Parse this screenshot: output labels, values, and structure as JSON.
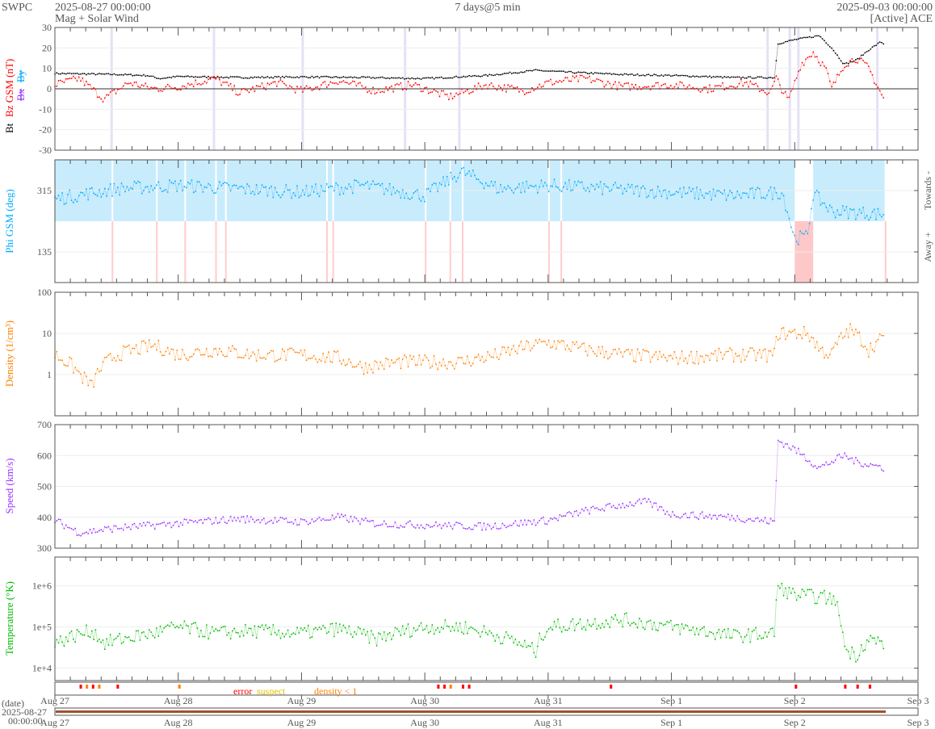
{
  "header": {
    "org": "SWPC",
    "start": "2025-08-27 00:00:00",
    "product": "Mag + Solar Wind",
    "span": "7 days@5 min",
    "end": "2025-09-03 00:00:00",
    "source": "[Active] ACE"
  },
  "footer": {
    "date_label": "(date)",
    "date_value": "2025-08-27",
    "time_value": "00:00:00"
  },
  "flags_legend": {
    "error": "error",
    "suspect": "suspect",
    "density": "density < 1"
  },
  "colors": {
    "bt": "#000000",
    "bz": "#ff0000",
    "bx": "#9933ff",
    "by": "#00aaff",
    "phi": "#00aaff",
    "density": "#ff8000",
    "speed": "#9933ff",
    "temperature": "#00bb00",
    "towards": "#c8ecfc",
    "away": "#ffc8c8"
  },
  "chart_data": {
    "type": "line",
    "x_unit": "days since 2025-08-27 00:00 UTC",
    "xlim": [
      0,
      7
    ],
    "x_ticks": [
      "Aug 27",
      "Aug 28",
      "Aug 29",
      "Aug 30",
      "Aug 31",
      "Sep 1",
      "Sep 2",
      "Sep 3"
    ],
    "panels": [
      {
        "id": "mag",
        "ylabels": {
          "bt": "Bt",
          "bz": "Bz GSM (nT)",
          "bx": "Bx",
          "by": "By"
        },
        "ylim": [
          -30,
          30
        ],
        "scale": "linear",
        "yticks": [
          "30",
          "20",
          "10",
          "0",
          "-10",
          "-20",
          "-30"
        ],
        "series": [
          {
            "name": "Bt",
            "color": "#000000",
            "points": [
              [
                0,
                7.5
              ],
              [
                0.5,
                7
              ],
              [
                0.75,
                6.5
              ],
              [
                0.85,
                5
              ],
              [
                1,
                6
              ],
              [
                1.5,
                5.5
              ],
              [
                2,
                5.8
              ],
              [
                2.5,
                5.5
              ],
              [
                3,
                5
              ],
              [
                3.5,
                6.5
              ],
              [
                3.9,
                9
              ],
              [
                4.2,
                8
              ],
              [
                4.6,
                7
              ],
              [
                5,
                6.5
              ],
              [
                5.5,
                5.5
              ],
              [
                5.84,
                5.5
              ],
              [
                5.86,
                22
              ],
              [
                6,
                24
              ],
              [
                6.2,
                26
              ],
              [
                6.3,
                20
              ],
              [
                6.4,
                12
              ],
              [
                6.5,
                14
              ],
              [
                6.6,
                19
              ],
              [
                6.7,
                23
              ],
              [
                6.73,
                21.5
              ]
            ]
          },
          {
            "name": "Bz GSM",
            "color": "#ff0000",
            "points": [
              [
                0,
                2
              ],
              [
                0.2,
                5
              ],
              [
                0.4,
                -5
              ],
              [
                0.6,
                3
              ],
              [
                0.8,
                0
              ],
              [
                1,
                1
              ],
              [
                1.3,
                5
              ],
              [
                1.5,
                -2
              ],
              [
                1.8,
                3
              ],
              [
                2,
                -1
              ],
              [
                2.3,
                4
              ],
              [
                2.6,
                -1
              ],
              [
                2.9,
                2
              ],
              [
                3.2,
                -4
              ],
              [
                3.5,
                2
              ],
              [
                3.8,
                -1
              ],
              [
                4,
                3
              ],
              [
                4.3,
                5
              ],
              [
                4.6,
                1
              ],
              [
                5,
                2
              ],
              [
                5.3,
                0
              ],
              [
                5.6,
                3
              ],
              [
                5.8,
                -2
              ],
              [
                5.85,
                5
              ],
              [
                5.95,
                -6
              ],
              [
                6.05,
                12
              ],
              [
                6.15,
                18
              ],
              [
                6.25,
                10
              ],
              [
                6.3,
                0
              ],
              [
                6.4,
                12
              ],
              [
                6.5,
                15
              ],
              [
                6.6,
                10
              ],
              [
                6.73,
                -6
              ]
            ]
          }
        ]
      },
      {
        "id": "phi",
        "ylabel": "Phi GSM (deg)",
        "ylim": [
          45,
          405
        ],
        "scale": "linear",
        "yticks": [
          "315",
          "135"
        ],
        "right_labels": {
          "towards": "Towards -",
          "away": "Away +"
        },
        "series": [
          {
            "name": "Phi",
            "color": "#00aaff",
            "points": [
              [
                0,
                290
              ],
              [
                0.5,
                320
              ],
              [
                1,
                330
              ],
              [
                1.5,
                320
              ],
              [
                2,
                310
              ],
              [
                2.5,
                330
              ],
              [
                3,
                300
              ],
              [
                3.3,
                370
              ],
              [
                3.6,
                320
              ],
              [
                4,
                330
              ],
              [
                4.5,
                320
              ],
              [
                5,
                310
              ],
              [
                5.5,
                300
              ],
              [
                5.9,
                310
              ],
              [
                6.0,
                175
              ],
              [
                6.1,
                180
              ],
              [
                6.15,
                305
              ],
              [
                6.3,
                255
              ],
              [
                6.73,
                245
              ]
            ]
          }
        ]
      },
      {
        "id": "density",
        "ylabel": "Density (1/cm³)",
        "ylim": [
          0.1,
          100
        ],
        "scale": "log",
        "yticks": [
          "100",
          "10",
          "1"
        ],
        "series": [
          {
            "name": "Density",
            "color": "#ff8000",
            "points": [
              [
                0,
                3
              ],
              [
                0.2,
                1
              ],
              [
                0.3,
                0.5
              ],
              [
                0.5,
                3
              ],
              [
                0.8,
                5
              ],
              [
                1,
                3
              ],
              [
                1.3,
                4
              ],
              [
                1.6,
                3
              ],
              [
                2,
                3
              ],
              [
                2.3,
                2.5
              ],
              [
                2.5,
                1.5
              ],
              [
                2.8,
                2
              ],
              [
                3,
                2
              ],
              [
                3.3,
                2
              ],
              [
                3.6,
                3
              ],
              [
                4,
                6
              ],
              [
                4.3,
                4
              ],
              [
                4.6,
                3
              ],
              [
                5,
                2.5
              ],
              [
                5.5,
                3
              ],
              [
                5.84,
                3
              ],
              [
                5.86,
                10
              ],
              [
                6.1,
                10
              ],
              [
                6.2,
                4
              ],
              [
                6.3,
                3
              ],
              [
                6.45,
                12
              ],
              [
                6.6,
                4
              ],
              [
                6.73,
                8
              ]
            ]
          }
        ]
      },
      {
        "id": "speed",
        "ylabel": "Speed (km/s)",
        "ylim": [
          300,
          700
        ],
        "scale": "linear",
        "yticks": [
          "700",
          "600",
          "500",
          "400",
          "300"
        ],
        "series": [
          {
            "name": "Speed",
            "color": "#9933ff",
            "points": [
              [
                0,
                390
              ],
              [
                0.2,
                350
              ],
              [
                0.5,
                365
              ],
              [
                1,
                380
              ],
              [
                1.5,
                395
              ],
              [
                2,
                385
              ],
              [
                2.3,
                400
              ],
              [
                2.6,
                380
              ],
              [
                3,
                375
              ],
              [
                3.5,
                370
              ],
              [
                4,
                390
              ],
              [
                4.3,
                420
              ],
              [
                4.6,
                440
              ],
              [
                4.8,
                450
              ],
              [
                5,
                410
              ],
              [
                5.5,
                400
              ],
              [
                5.84,
                385
              ],
              [
                5.86,
                650
              ],
              [
                6,
                620
              ],
              [
                6.2,
                560
              ],
              [
                6.4,
                600
              ],
              [
                6.5,
                580
              ],
              [
                6.73,
                560
              ]
            ]
          }
        ]
      },
      {
        "id": "temperature",
        "ylabel": "Temperature (°K)",
        "ylim": [
          5000,
          5000000
        ],
        "scale": "log",
        "yticks": [
          "1e+6",
          "1e+5",
          "1e+4"
        ],
        "series": [
          {
            "name": "Temperature",
            "color": "#00bb00",
            "points": [
              [
                0,
                40000
              ],
              [
                0.3,
                80000
              ],
              [
                0.4,
                40000
              ],
              [
                0.8,
                70000
              ],
              [
                1,
                100000
              ],
              [
                1.3,
                70000
              ],
              [
                1.6,
                80000
              ],
              [
                2,
                70000
              ],
              [
                2.3,
                90000
              ],
              [
                2.6,
                50000
              ],
              [
                3,
                100000
              ],
              [
                3.3,
                100000
              ],
              [
                3.6,
                60000
              ],
              [
                3.9,
                25000
              ],
              [
                4,
                100000
              ],
              [
                4.3,
                120000
              ],
              [
                4.6,
                150000
              ],
              [
                5,
                100000
              ],
              [
                5.5,
                60000
              ],
              [
                5.84,
                70000
              ],
              [
                5.86,
                900000
              ],
              [
                6,
                600000
              ],
              [
                6.3,
                500000
              ],
              [
                6.4,
                30000
              ],
              [
                6.5,
                20000
              ],
              [
                6.6,
                50000
              ],
              [
                6.73,
                40000
              ]
            ]
          }
        ]
      }
    ],
    "flags": [
      [
        0.2,
        "error"
      ],
      [
        0.25,
        "density"
      ],
      [
        0.3,
        "error"
      ],
      [
        0.35,
        "density"
      ],
      [
        0.5,
        "error"
      ],
      [
        1.0,
        "density"
      ],
      [
        3.1,
        "error"
      ],
      [
        3.15,
        "error"
      ],
      [
        3.2,
        "density"
      ],
      [
        3.3,
        "error"
      ],
      [
        3.35,
        "error"
      ],
      [
        4.5,
        "error"
      ],
      [
        6.0,
        "error"
      ],
      [
        6.4,
        "error"
      ],
      [
        6.5,
        "error"
      ],
      [
        6.6,
        "error"
      ]
    ]
  }
}
